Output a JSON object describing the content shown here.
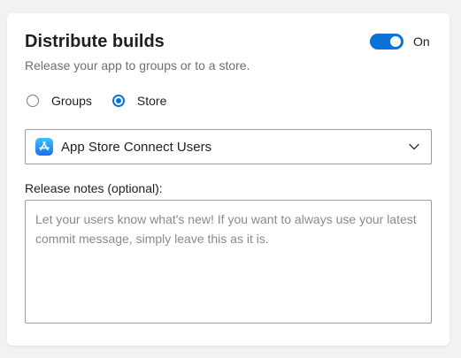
{
  "card": {
    "title": "Distribute builds",
    "subtitle": "Release your app to groups or to a store.",
    "toggle": {
      "state": "on",
      "label": "On"
    }
  },
  "destination": {
    "options": [
      {
        "label": "Groups",
        "selected": false
      },
      {
        "label": "Store",
        "selected": true
      }
    ]
  },
  "store_select": {
    "icon": "app-store-icon",
    "value": "App Store Connect Users"
  },
  "release_notes": {
    "label": "Release notes (optional):",
    "value": "",
    "placeholder": "Let your users know what's new! If you want to always use your latest commit message, simply leave this as it is."
  },
  "colors": {
    "accent": "#0b72d6",
    "page_background": "#f2f2f2",
    "card_background": "#ffffff"
  }
}
